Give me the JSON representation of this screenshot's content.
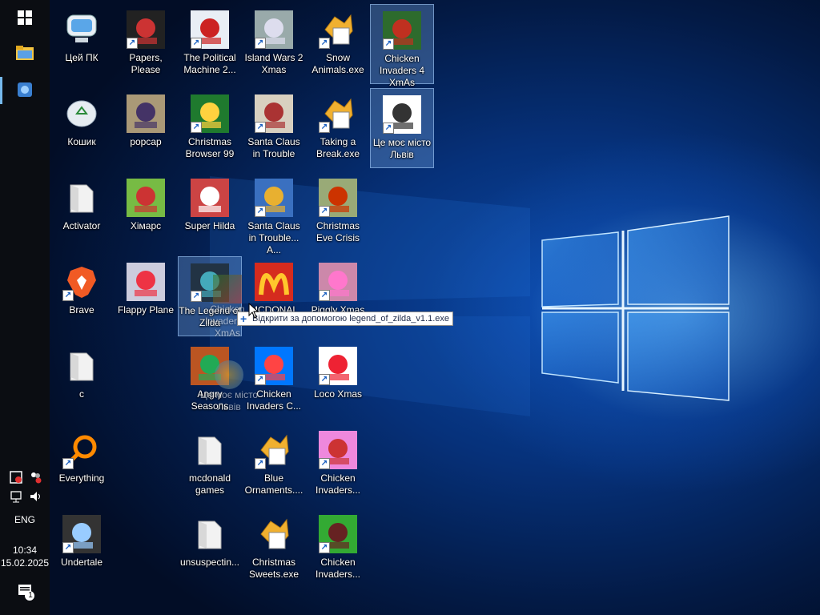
{
  "taskbar": {
    "items": [
      {
        "name": "start-button",
        "icon": "windows-logo-icon"
      },
      {
        "name": "file-explorer-button",
        "icon": "folder-icon"
      },
      {
        "name": "pinned-app-button",
        "icon": "app-icon",
        "active": true
      }
    ],
    "tray": {
      "language": "ENG",
      "time": "10:34",
      "date": "15.02.2025",
      "notification_count": "1"
    }
  },
  "desktop": {
    "icons": [
      {
        "label": "Цей ПК",
        "icon": "computer-icon"
      },
      {
        "label": "Papers, Please",
        "icon": "game-icon",
        "shortcut": true
      },
      {
        "label": "The Political Machine 2...",
        "icon": "game-icon",
        "shortcut": true
      },
      {
        "label": "Island Wars 2 Xmas",
        "icon": "game-icon",
        "shortcut": true
      },
      {
        "label": "Snow Animals.exe",
        "icon": "exe-icon",
        "shortcut": true
      },
      {
        "label": "Chicken Invaders 4 XmAs",
        "icon": "game-icon",
        "shortcut": true,
        "selected": true
      },
      {
        "label": "Кошик",
        "icon": "recycle-bin-icon"
      },
      {
        "label": "popcap",
        "icon": "game-icon"
      },
      {
        "label": "Christmas Browser 99",
        "icon": "game-icon",
        "shortcut": true
      },
      {
        "label": "Santa Claus in Trouble",
        "icon": "game-icon",
        "shortcut": true
      },
      {
        "label": "Taking a Break.exe",
        "icon": "exe-icon",
        "shortcut": true
      },
      {
        "label": "Це моє місто Львів",
        "icon": "game-icon",
        "shortcut": true,
        "selected": true
      },
      {
        "label": "Activator",
        "icon": "folder-icon"
      },
      {
        "label": "Хімарс",
        "icon": "game-icon"
      },
      {
        "label": "Super Hilda",
        "icon": "game-icon"
      },
      {
        "label": "Santa Claus in Trouble... A...",
        "icon": "game-icon",
        "shortcut": true
      },
      {
        "label": "Christmas Eve Crisis",
        "icon": "game-icon",
        "shortcut": true
      },
      {
        "label": "Brave",
        "icon": "brave-icon",
        "shortcut": true
      },
      {
        "label": "Flappy Plane",
        "icon": "game-icon"
      },
      {
        "label": "The Legend of Zilda",
        "icon": "game-icon",
        "shortcut": true,
        "selected": true
      },
      {
        "label": "MCDONAL",
        "icon": "mcdonalds-icon"
      },
      {
        "label": "Piggly Xmas",
        "icon": "game-icon",
        "shortcut": true
      },
      {
        "label": "c",
        "icon": "folder-icon"
      },
      {
        "label": "Angry Seasons",
        "icon": "game-icon"
      },
      {
        "label": "Chicken Invaders C...",
        "icon": "game-icon",
        "shortcut": true
      },
      {
        "label": "Loco Xmas",
        "icon": "game-icon",
        "shortcut": true
      },
      {
        "label": "Everything",
        "icon": "search-app-icon",
        "shortcut": true
      },
      {
        "label": "mcdonald games",
        "icon": "folder-icon"
      },
      {
        "label": "Blue Ornaments....",
        "icon": "exe-icon",
        "shortcut": true
      },
      {
        "label": "Chicken Invaders...",
        "icon": "game-icon",
        "shortcut": true
      },
      {
        "label": "Undertale",
        "icon": "game-icon",
        "shortcut": true
      },
      {
        "label": "unsuspectin...",
        "icon": "folder-icon"
      },
      {
        "label": "Christmas Sweets.exe",
        "icon": "exe-icon"
      },
      {
        "label": "Chicken Invaders...",
        "icon": "game-icon",
        "shortcut": true
      }
    ],
    "drag": {
      "ghost_labels": [
        "Chicken Invaders 4 XmAs",
        "Це моє місто Львів"
      ],
      "tooltip": "Відкрити за допомогою legend_of_zilda_v1.1.exe"
    }
  },
  "colors": {
    "taskbar_bg": "#0b0d12",
    "selection": "#78aae6",
    "accent": "#76b9ed"
  }
}
